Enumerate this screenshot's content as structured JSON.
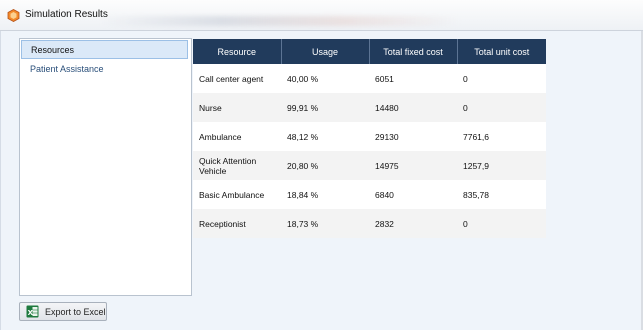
{
  "window": {
    "title": "Simulation Results",
    "app_icon": "app-hexagon-icon",
    "accent": "#e8711c"
  },
  "sidebar": {
    "items": [
      {
        "label": "Resources",
        "selected": true
      },
      {
        "label": "Patient Assistance",
        "selected": false
      }
    ]
  },
  "table": {
    "header_color": "#213b5c",
    "columns": [
      "Resource",
      "Usage",
      "Total fixed cost",
      "Total unit cost"
    ],
    "rows": [
      {
        "resource": "Call center agent",
        "usage": "40,00 %",
        "fixed_cost": "6051",
        "unit_cost": "0"
      },
      {
        "resource": "Nurse",
        "usage": "99,91 %",
        "fixed_cost": "14480",
        "unit_cost": "0"
      },
      {
        "resource": "Ambulance",
        "usage": "48,12 %",
        "fixed_cost": "29130",
        "unit_cost": "7761,6"
      },
      {
        "resource": "Quick Attention Vehicle",
        "usage": "20,80 %",
        "fixed_cost": "14975",
        "unit_cost": "1257,9"
      },
      {
        "resource": "Basic Ambulance",
        "usage": "18,84 %",
        "fixed_cost": "6840",
        "unit_cost": "835,78"
      },
      {
        "resource": "Receptionist",
        "usage": "18,73 %",
        "fixed_cost": "2832",
        "unit_cost": "0"
      }
    ]
  },
  "footer": {
    "export_label": "Export to Excel",
    "export_icon": "excel-icon"
  }
}
